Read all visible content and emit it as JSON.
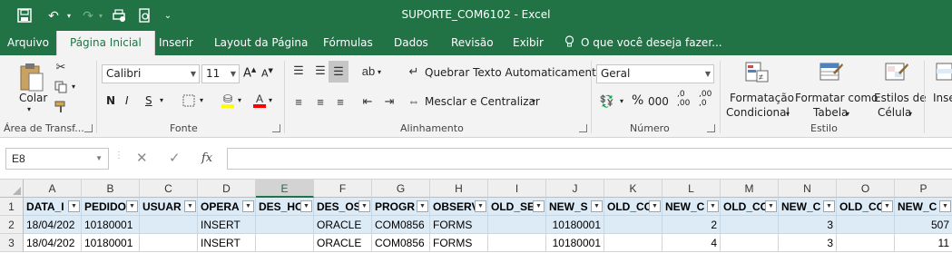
{
  "window": {
    "title": "SUPORTE_COM6102 - Excel"
  },
  "quick_access": {
    "save_icon": "save-icon",
    "undo_icon": "undo-icon",
    "redo_icon": "redo-icon",
    "customize_icon": "customize-icon"
  },
  "tabs": [
    {
      "label": "Arquivo"
    },
    {
      "label": "Página Inicial"
    },
    {
      "label": "Inserir"
    },
    {
      "label": "Layout da Página"
    },
    {
      "label": "Fórmulas"
    },
    {
      "label": "Dados"
    },
    {
      "label": "Revisão"
    },
    {
      "label": "Exibir"
    }
  ],
  "tell_me": "O que você deseja fazer...",
  "ribbon": {
    "clipboard": {
      "paste_label": "Colar",
      "group_label": "Área de Transf..."
    },
    "font": {
      "font_name": "Calibri",
      "font_size": "11",
      "bold": "N",
      "italic": "I",
      "underline": "S",
      "group_label": "Fonte"
    },
    "alignment": {
      "wrap_text": "Quebrar Texto Automaticamente",
      "merge_center": "Mesclar e Centralizar",
      "group_label": "Alinhamento"
    },
    "number": {
      "format": "Geral",
      "percent": "%",
      "thousands": "000",
      "dec_increase": ",0 ,00",
      "dec_decrease": ",00 ,0",
      "group_label": "Número"
    },
    "styles": {
      "conditional_line1": "Formatação",
      "conditional_line2": "Condicional",
      "format_table_line1": "Formatar como",
      "format_table_line2": "Tabela",
      "cell_styles_line1": "Estilos de",
      "cell_styles_line2": "Célula",
      "group_label": "Estilo"
    },
    "insert_partial": "Inse"
  },
  "formula_bar": {
    "name_box": "E8",
    "fx": "fx",
    "value": ""
  },
  "sheet": {
    "columns": [
      "A",
      "B",
      "C",
      "D",
      "E",
      "F",
      "G",
      "H",
      "I",
      "J",
      "K",
      "L",
      "M",
      "N",
      "O",
      "P"
    ],
    "selected_column": "E",
    "row_numbers": [
      "1",
      "2",
      "3"
    ],
    "header_row": [
      "DATA_I",
      "PEDIDO",
      "USUAR",
      "OPERA",
      "DES_HO",
      "DES_OS",
      "PROGR",
      "OBSERV",
      "OLD_SE",
      "NEW_S",
      "OLD_CO",
      "NEW_C",
      "OLD_CO",
      "NEW_C",
      "OLD_CO",
      "NEW_C"
    ],
    "rows": [
      [
        "18/04/202",
        "10180001",
        "",
        "INSERT",
        "",
        "ORACLE",
        "COM0856",
        "FORMS",
        "",
        "10180001",
        "",
        "2",
        "",
        "3",
        "",
        "507"
      ],
      [
        "18/04/202",
        "10180001",
        "",
        "INSERT",
        "",
        "ORACLE",
        "COM0856",
        "FORMS",
        "",
        "10180001",
        "",
        "4",
        "",
        "3",
        "",
        "11"
      ]
    ],
    "numeric_columns": [
      11,
      13,
      15,
      9
    ]
  },
  "colors": {
    "excel_green": "#217346",
    "table_band": "#ddebf7"
  }
}
